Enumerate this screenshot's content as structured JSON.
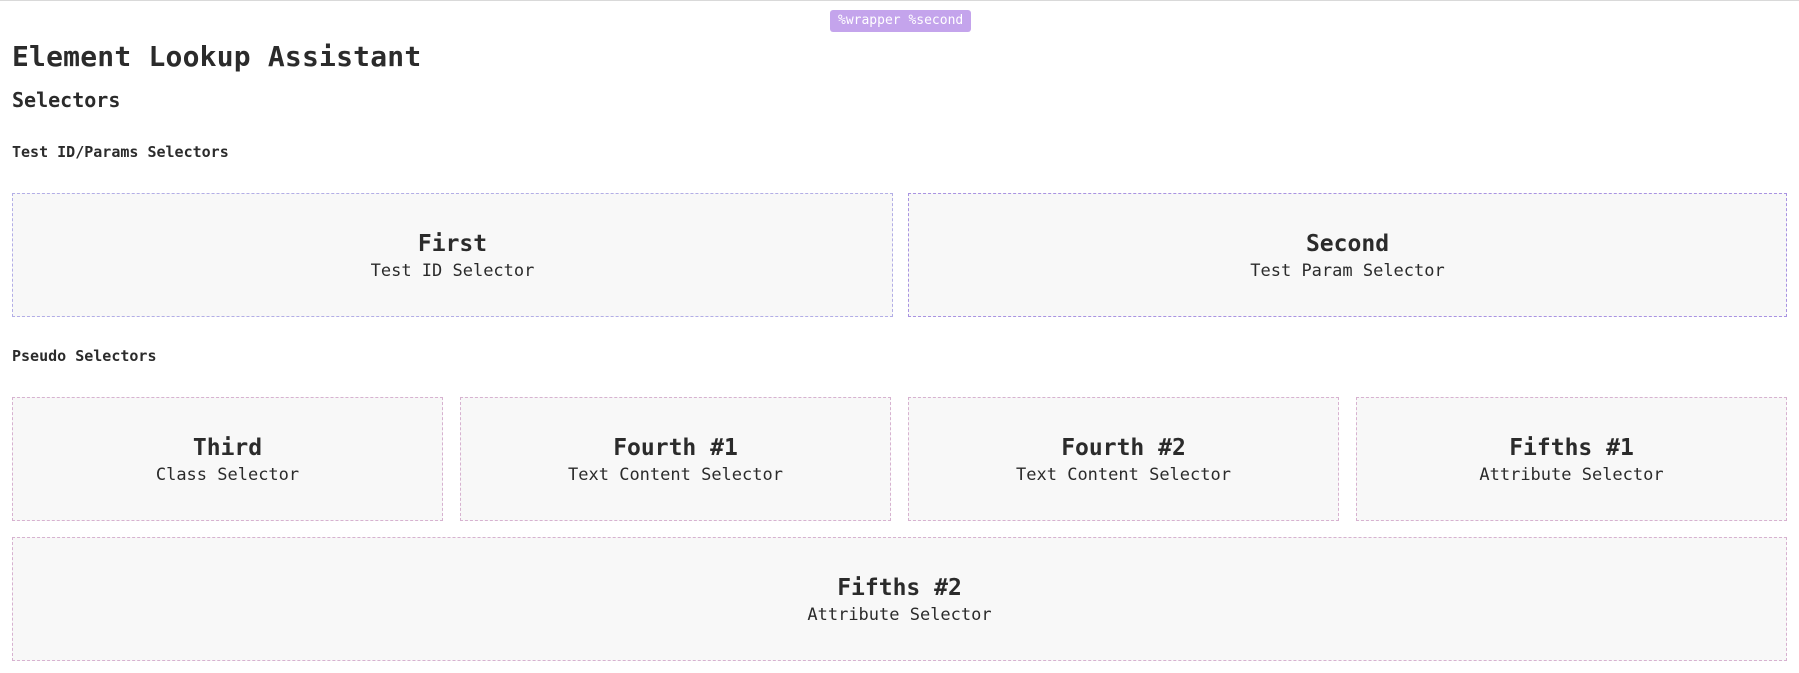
{
  "overlay": {
    "badge": "%wrapper %second"
  },
  "app": {
    "title": "Element Lookup Assistant"
  },
  "section": {
    "title": "Selectors"
  },
  "groups": [
    {
      "title": "Test ID/Params Selectors",
      "cards": [
        {
          "title": "First",
          "subtitle": "Test ID Selector"
        },
        {
          "title": "Second",
          "subtitle": "Test Param Selector"
        }
      ]
    },
    {
      "title": "Pseudo Selectors",
      "cards": [
        {
          "title": "Third",
          "subtitle": "Class Selector"
        },
        {
          "title": "Fourth #1",
          "subtitle": "Text Content Selector"
        },
        {
          "title": "Fourth #2",
          "subtitle": "Text Content Selector"
        },
        {
          "title": "Fifths #1",
          "subtitle": "Attribute Selector"
        },
        {
          "title": "Fifths #2",
          "subtitle": "Attribute Selector"
        }
      ]
    }
  ],
  "colors": {
    "badge_bg": "#c4a4ec",
    "card_bg": "#f8f8f8",
    "test_id_border": "#b3aee6",
    "pseudo_border": "#d7b2d0"
  }
}
